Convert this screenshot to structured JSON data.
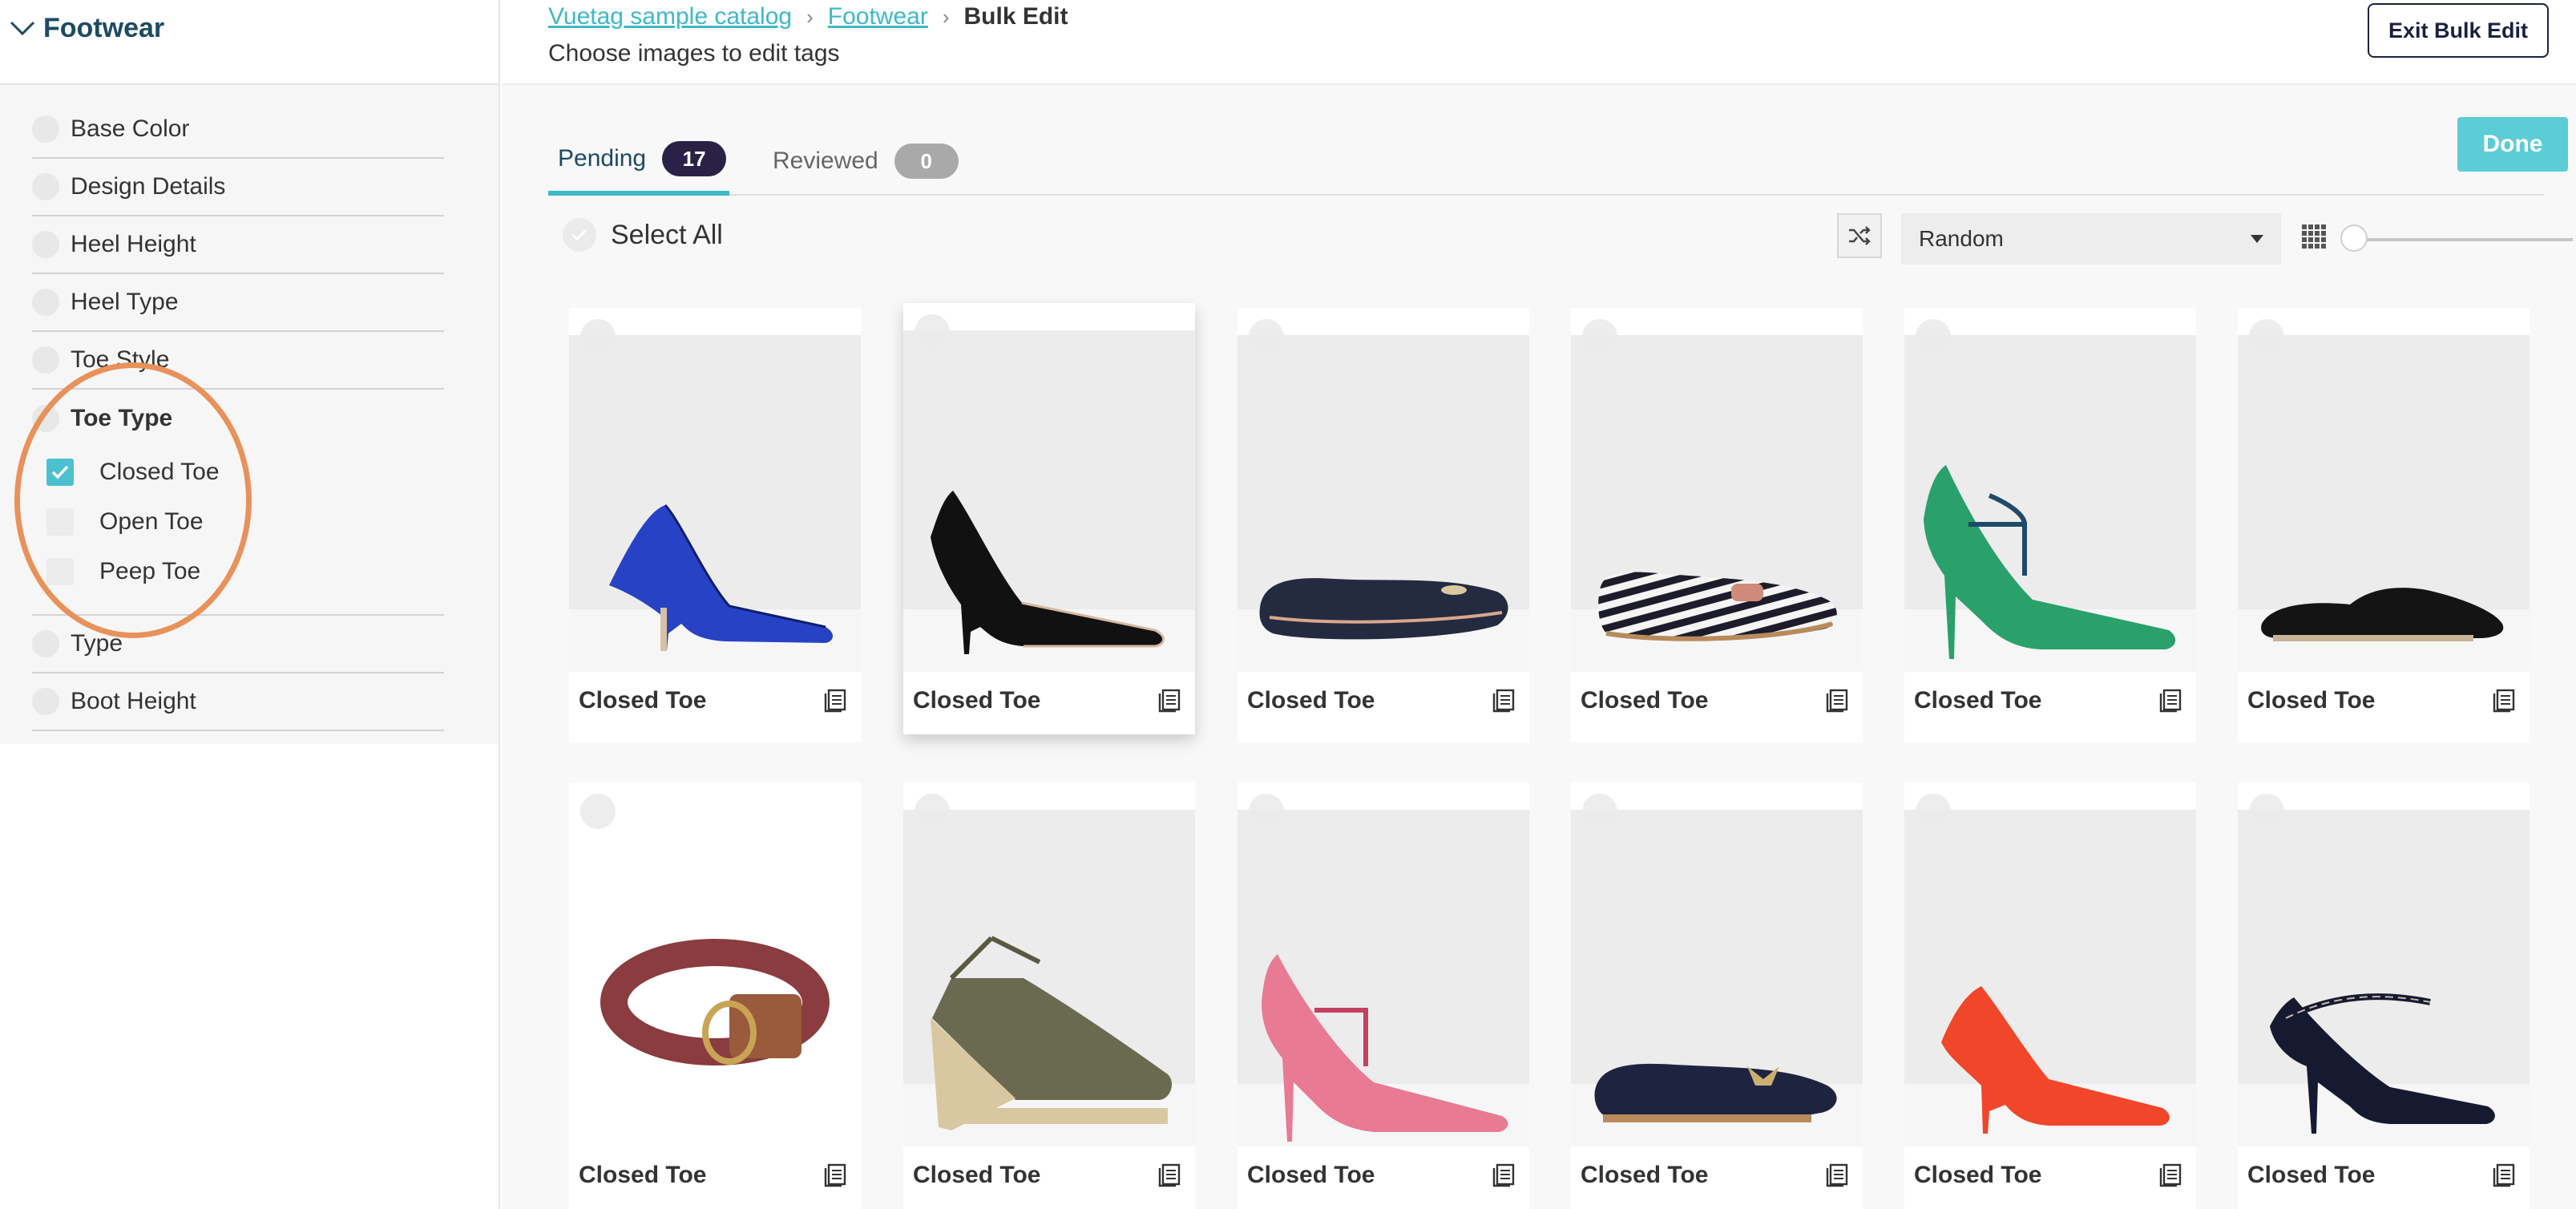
{
  "sidebar": {
    "title": "Footwear",
    "attributes_top": [
      {
        "label": "Base Color"
      },
      {
        "label": "Design Details"
      },
      {
        "label": "Heel Height"
      },
      {
        "label": "Heel Type"
      },
      {
        "label": "Toe Style"
      }
    ],
    "toe_type": {
      "label": "Toe Type",
      "options": [
        {
          "label": "Closed Toe",
          "checked": true
        },
        {
          "label": "Open Toe",
          "checked": false
        },
        {
          "label": "Peep Toe",
          "checked": false
        }
      ]
    },
    "attributes_bottom": [
      {
        "label": "Type"
      },
      {
        "label": "Boot Height"
      }
    ]
  },
  "header": {
    "breadcrumb": [
      "Vuetag sample catalog",
      "Footwear",
      "Bulk Edit"
    ],
    "subtitle": "Choose images to edit tags",
    "exit_label": "Exit Bulk Edit"
  },
  "tabs": {
    "pending": {
      "label": "Pending",
      "count": "17"
    },
    "reviewed": {
      "label": "Reviewed",
      "count": "0"
    },
    "done_label": "Done"
  },
  "toolbar": {
    "select_all_label": "Select All",
    "sort_value": "Random"
  },
  "colors": {
    "accent": "#3eb8c8",
    "done": "#5cccd6",
    "badge_dark": "#2a2246",
    "highlight": "#e8915a"
  },
  "products": [
    {
      "tag": "Closed Toe",
      "item": "blue-suede-pump"
    },
    {
      "tag": "Closed Toe",
      "item": "black-suede-pump"
    },
    {
      "tag": "Closed Toe",
      "item": "navy-ballet-flat"
    },
    {
      "tag": "Closed Toe",
      "item": "striped-loafer"
    },
    {
      "tag": "Closed Toe",
      "item": "green-t-bar-heel"
    },
    {
      "tag": "Closed Toe",
      "item": "black-penny-loafer"
    },
    {
      "tag": "Closed Toe",
      "item": "leather-belt"
    },
    {
      "tag": "Closed Toe",
      "item": "khaki-espadrille"
    },
    {
      "tag": "Closed Toe",
      "item": "pink-t-bar-heel"
    },
    {
      "tag": "Closed Toe",
      "item": "navy-velvet-slipper"
    },
    {
      "tag": "Closed Toe",
      "item": "red-suede-pump"
    },
    {
      "tag": "Closed Toe",
      "item": "navy-scallop-heel"
    }
  ]
}
